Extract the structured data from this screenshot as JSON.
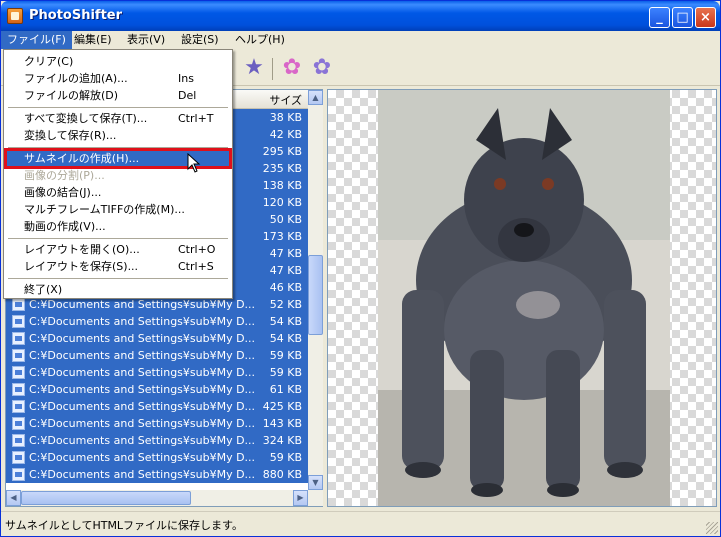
{
  "window": {
    "title": "PhotoShifter"
  },
  "titlebar": {
    "minimize": "_",
    "maximize": "□",
    "close": "×"
  },
  "menubar": [
    {
      "label": "ファイル(F)"
    },
    {
      "label": "編集(E)"
    },
    {
      "label": "表示(V)"
    },
    {
      "label": "設定(S)"
    },
    {
      "label": "ヘルプ(H)"
    }
  ],
  "file_menu": {
    "items": [
      {
        "label": "クリア(C)",
        "shortcut": ""
      },
      {
        "label": "ファイルの追加(A)...",
        "shortcut": "Ins"
      },
      {
        "label": "ファイルの解放(D)",
        "shortcut": "Del"
      },
      {
        "label": "すべて変換して保存(T)...",
        "shortcut": "Ctrl+T"
      },
      {
        "label": "変換して保存(R)...",
        "shortcut": ""
      },
      {
        "label": "サムネイルの作成(H)...",
        "shortcut": ""
      },
      {
        "label": "画像の分割(P)...",
        "shortcut": ""
      },
      {
        "label": "画像の結合(J)...",
        "shortcut": ""
      },
      {
        "label": "マルチフレームTIFFの作成(M)...",
        "shortcut": ""
      },
      {
        "label": "動画の作成(V)...",
        "shortcut": ""
      },
      {
        "label": "レイアウトを開く(O)...",
        "shortcut": "Ctrl+O"
      },
      {
        "label": "レイアウトを保存(S)...",
        "shortcut": "Ctrl+S"
      },
      {
        "label": "終了(X)",
        "shortcut": ""
      }
    ]
  },
  "file_list": {
    "header_size": "サイズ",
    "rows": [
      {
        "path": "",
        "size": "38 KB"
      },
      {
        "path": "",
        "size": "42 KB"
      },
      {
        "path": "",
        "size": "295 KB"
      },
      {
        "path": "",
        "size": "235 KB"
      },
      {
        "path": "",
        "size": "138 KB"
      },
      {
        "path": "",
        "size": "120 KB"
      },
      {
        "path": "",
        "size": "50 KB"
      },
      {
        "path": "",
        "size": "173 KB"
      },
      {
        "path": "",
        "size": "47 KB"
      },
      {
        "path": "",
        "size": "47 KB"
      },
      {
        "path": "",
        "size": "46 KB"
      },
      {
        "path": "C:¥Documents and Settings¥sub¥My D...",
        "size": "52 KB"
      },
      {
        "path": "C:¥Documents and Settings¥sub¥My D...",
        "size": "54 KB"
      },
      {
        "path": "C:¥Documents and Settings¥sub¥My D...",
        "size": "54 KB"
      },
      {
        "path": "C:¥Documents and Settings¥sub¥My D...",
        "size": "59 KB"
      },
      {
        "path": "C:¥Documents and Settings¥sub¥My D...",
        "size": "59 KB"
      },
      {
        "path": "C:¥Documents and Settings¥sub¥My D...",
        "size": "61 KB"
      },
      {
        "path": "C:¥Documents and Settings¥sub¥My D...",
        "size": "425 KB"
      },
      {
        "path": "C:¥Documents and Settings¥sub¥My D...",
        "size": "143 KB"
      },
      {
        "path": "C:¥Documents and Settings¥sub¥My D...",
        "size": "324 KB"
      },
      {
        "path": "C:¥Documents and Settings¥sub¥My D...",
        "size": "59 KB"
      },
      {
        "path": "C:¥Documents and Settings¥sub¥My D...",
        "size": "880 KB"
      }
    ]
  },
  "statusbar": {
    "text": "サムネイルとしてHTMLファイルに保存します。"
  }
}
